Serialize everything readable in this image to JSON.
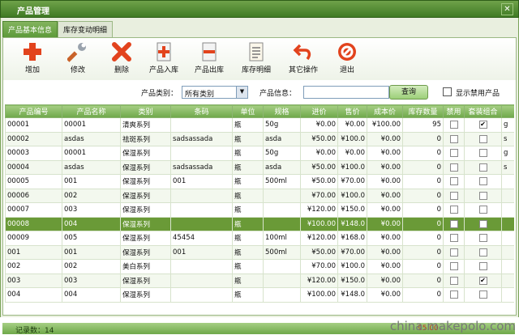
{
  "window": {
    "title": "产品管理",
    "close": "✕"
  },
  "tabs": [
    {
      "label": "产品基本信息",
      "active": true
    },
    {
      "label": "库存变动明细",
      "active": false
    }
  ],
  "toolbar": {
    "add": "增加",
    "edit": "修改",
    "delete": "删除",
    "stock_in": "产品入库",
    "stock_out": "产品出库",
    "stock_detail": "库存明细",
    "other": "其它操作",
    "exit": "退出"
  },
  "filter": {
    "category_label": "产品类别：",
    "category_value": "所有类别",
    "info_label": "产品信息：",
    "info_value": "",
    "query_button": "查询",
    "show_disabled_label": "显示禁用产品"
  },
  "table": {
    "headers": [
      "产品编号",
      "产品名称",
      "类别",
      "条码",
      "单位",
      "规格",
      "进价",
      "售价",
      "成本价",
      "库存数量",
      "禁用",
      "套装组合"
    ],
    "rows": [
      [
        "00001",
        "00001",
        "清爽系列",
        "",
        "瓶",
        "50g",
        "¥0.00",
        "¥0.00",
        "¥100.00",
        "95",
        "",
        "✔",
        "g"
      ],
      [
        "00002",
        "asdas",
        "祛斑系列",
        "sadsassada",
        "瓶",
        "asda",
        "¥50.00",
        "¥100.0",
        "¥0.00",
        "0",
        "",
        "",
        "s"
      ],
      [
        "00003",
        "00001",
        "保湿系列",
        "",
        "瓶",
        "50g",
        "¥0.00",
        "¥0.00",
        "¥0.00",
        "0",
        "",
        "",
        "g"
      ],
      [
        "00004",
        "asdas",
        "保湿系列",
        "sadsassada",
        "瓶",
        "asda",
        "¥50.00",
        "¥100.0",
        "¥0.00",
        "0",
        "",
        "",
        "s"
      ],
      [
        "00005",
        "001",
        "保湿系列",
        "001",
        "瓶",
        "500ml",
        "¥50.00",
        "¥70.00",
        "¥0.00",
        "0",
        "",
        "",
        ""
      ],
      [
        "00006",
        "002",
        "保湿系列",
        "",
        "瓶",
        "",
        "¥70.00",
        "¥100.0",
        "¥0.00",
        "0",
        "",
        "",
        ""
      ],
      [
        "00007",
        "003",
        "保湿系列",
        "",
        "瓶",
        "",
        "¥120.00",
        "¥150.0",
        "¥0.00",
        "0",
        "",
        "",
        ""
      ],
      [
        "00008",
        "004",
        "保湿系列",
        "",
        "瓶",
        "",
        "¥100.00",
        "¥148.0",
        "¥0.00",
        "0",
        "",
        "",
        ""
      ],
      [
        "00009",
        "005",
        "保湿系列",
        "45454",
        "瓶",
        "100ml",
        "¥120.00",
        "¥168.0",
        "¥0.00",
        "0",
        "",
        "",
        ""
      ],
      [
        "001",
        "001",
        "保湿系列",
        "001",
        "瓶",
        "500ml",
        "¥50.00",
        "¥70.00",
        "¥0.00",
        "0",
        "",
        "",
        ""
      ],
      [
        "002",
        "002",
        "美白系列",
        "",
        "瓶",
        "",
        "¥70.00",
        "¥100.0",
        "¥0.00",
        "0",
        "",
        "",
        ""
      ],
      [
        "003",
        "003",
        "保湿系列",
        "",
        "瓶",
        "",
        "¥120.00",
        "¥150.0",
        "¥0.00",
        "0",
        "",
        "✔",
        ""
      ],
      [
        "004",
        "004",
        "保湿系列",
        "",
        "瓶",
        "",
        "¥100.00",
        "¥148.0",
        "¥0.00",
        "0",
        "",
        "",
        ""
      ]
    ],
    "selected_row": 7
  },
  "status": {
    "count": "记录数：14",
    "total": "95.00"
  },
  "watermark": "china.makepolo.com",
  "colors": {
    "accent": "#5d9a3a",
    "selected_row": "#6a9a37"
  }
}
